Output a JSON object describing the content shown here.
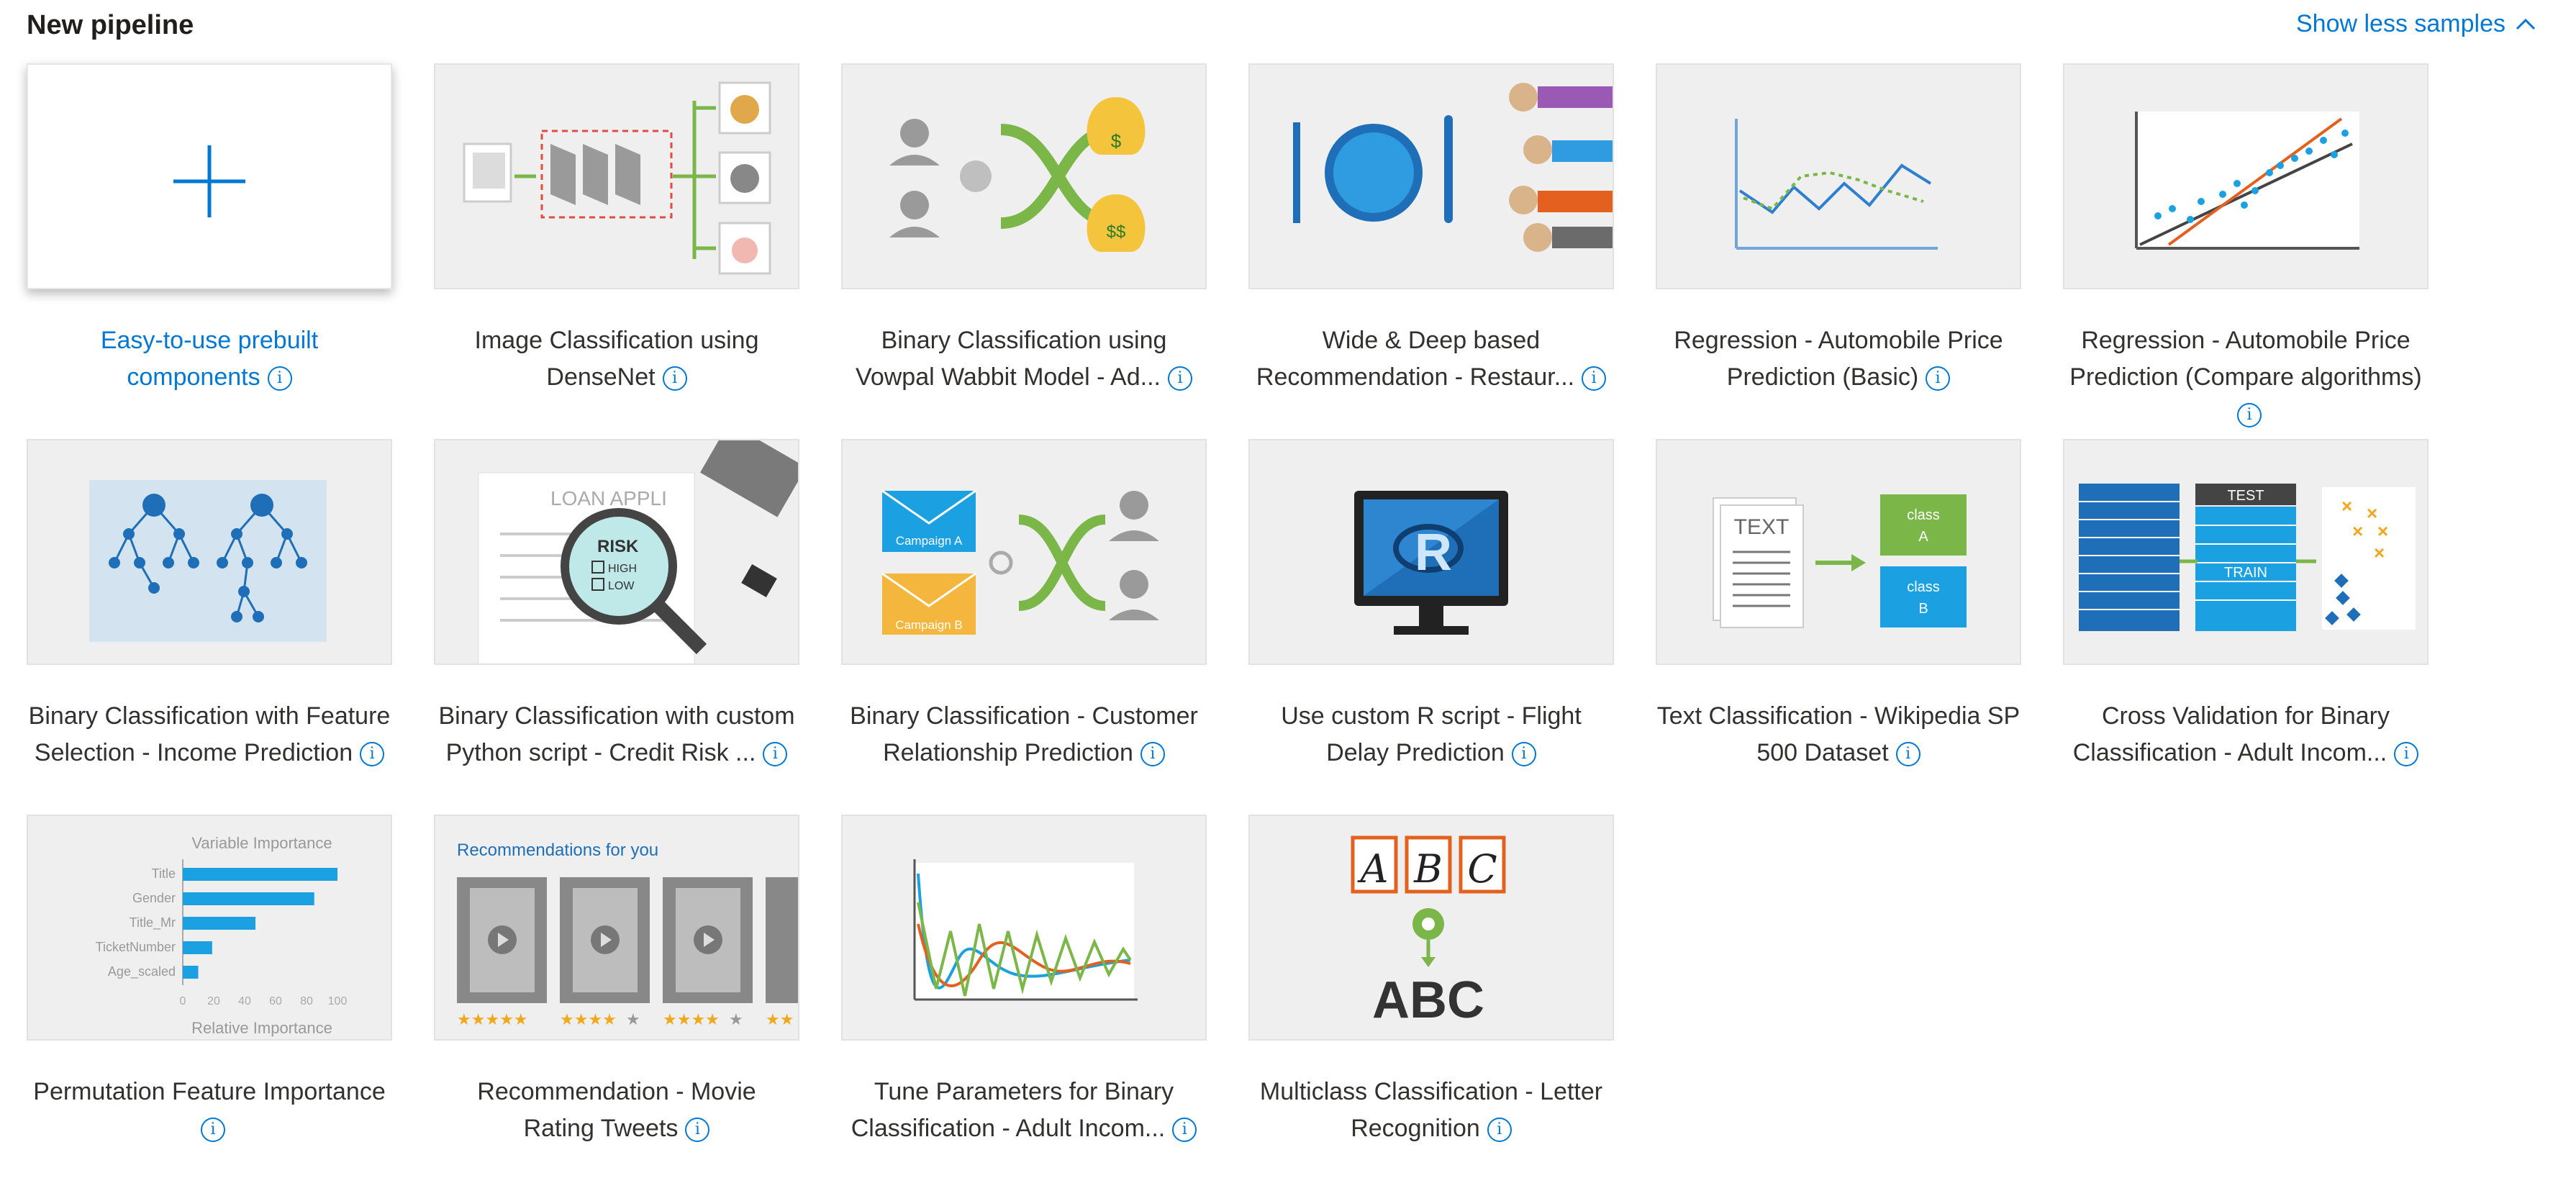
{
  "header": {
    "title": "New pipeline",
    "toggle_label": "Show less samples"
  },
  "cards": [
    {
      "title": "Easy-to-use prebuilt components",
      "line1": "Easy-to-use prebuilt",
      "line2": "components",
      "icon": "plus-icon"
    },
    {
      "title": "Image Classification using DenseNet",
      "line1": "Image Classification using",
      "line2": "DenseNet"
    },
    {
      "title": "Binary Classification using Vowpal Wabbit Model - Ad...",
      "line1": "Binary Classification using",
      "line2": "Vowpal Wabbit Model - Ad..."
    },
    {
      "title": "Wide & Deep based Recommendation - Restaur...",
      "line1": "Wide & Deep based",
      "line2": "Recommendation - Restaur..."
    },
    {
      "title": "Regression - Automobile Price Prediction (Basic)",
      "line1": "Regression - Automobile Price",
      "line2": "Prediction (Basic)"
    },
    {
      "title": "Regression - Automobile Price Prediction (Compare algorithms)",
      "line1": "Regression - Automobile Price",
      "line2": "Prediction (Compare algorithms)"
    },
    {
      "title": "Binary Classification with Feature Selection - Income Prediction",
      "line1": "Binary Classification with Feature",
      "line2": "Selection - Income Prediction"
    },
    {
      "title": "Binary Classification with custom Python script - Credit Risk ...",
      "line1": "Binary Classification with custom",
      "line2": "Python script - Credit Risk ..."
    },
    {
      "title": "Binary Classification - Customer Relationship Prediction",
      "line1": "Binary Classification - Customer",
      "line2": "Relationship Prediction"
    },
    {
      "title": "Use custom R script - Flight Delay Prediction",
      "line1": "Use custom R script - Flight",
      "line2": "Delay Prediction"
    },
    {
      "title": "Text Classification - Wikipedia SP 500 Dataset",
      "line1": "Text Classification - Wikipedia SP",
      "line2": "500 Dataset"
    },
    {
      "title": "Cross Validation for Binary Classification - Adult Incom...",
      "line1": "Cross Validation for Binary",
      "line2": "Classification - Adult Incom..."
    },
    {
      "title": "Permutation Feature Importance",
      "line1": "Permutation Feature Importance",
      "line2": ""
    },
    {
      "title": "Recommendation - Movie Rating Tweets",
      "line1": "Recommendation - Movie",
      "line2": "Rating Tweets"
    },
    {
      "title": "Tune Parameters for Binary Classification - Adult Incom...",
      "line1": "Tune Parameters for Binary",
      "line2": "Classification - Adult Incom..."
    },
    {
      "title": "Multiclass Classification - Letter Recognition",
      "line1": "Multiclass Classification - Letter",
      "line2": "Recognition"
    }
  ],
  "thumb_text": {
    "loan": "LOAN APPLI",
    "risk": "RISK",
    "high": "HIGH",
    "low": "LOW",
    "campaign_a": "Campaign A",
    "campaign_b": "Campaign B",
    "r_letter": "R",
    "text_doc": "TEXT",
    "class_a_1": "class",
    "class_a_2": "A",
    "class_b_1": "class",
    "class_b_2": "B",
    "test": "TEST",
    "train": "TRAIN",
    "var_importance": "Variable Importance",
    "features": [
      "Title",
      "Gender",
      "Title_Mr",
      "TicketNumber",
      "Age_scaled"
    ],
    "rel_importance": "Relative Importance",
    "axis_ticks": [
      "0",
      "20",
      "40",
      "60",
      "80",
      "100"
    ],
    "recs_title": "Recommendations for you",
    "abc": "ABC",
    "hand_letters": [
      "A",
      "B",
      "C"
    ],
    "dollar1": "$",
    "dollar2": "$$"
  },
  "feature_importance": [
    100,
    85,
    47,
    19,
    10
  ],
  "colors": {
    "accent": "#0078d4",
    "green": "#7ab648",
    "blue": "#1ba1e2",
    "orange": "#e3601e",
    "red": "#e34b3c"
  }
}
